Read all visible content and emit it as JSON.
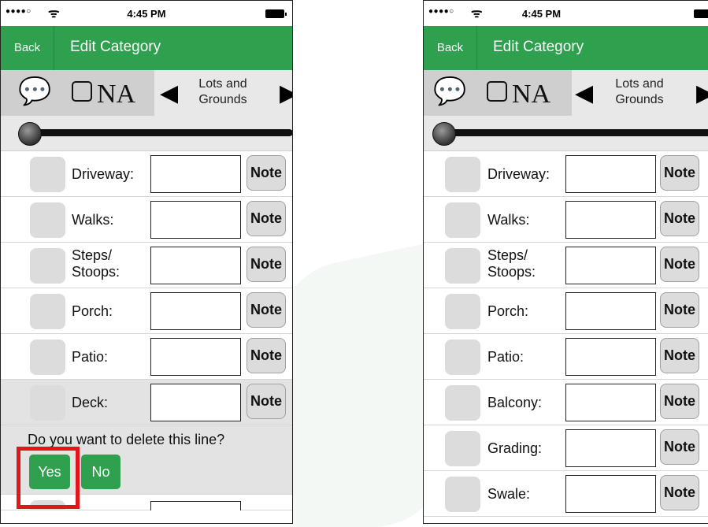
{
  "status": {
    "signal": "●●●●○",
    "wifi": "ᯤ",
    "time": "4:45 PM"
  },
  "nav": {
    "back": "Back",
    "title": "Edit Category"
  },
  "toolbar": {
    "chat_glyph": "💬",
    "na_label": "NA",
    "prev_glyph": "◀",
    "category_line1": "Lots and",
    "category_line2": "Grounds",
    "next_glyph": "▶"
  },
  "note_label": "Note",
  "left_rows": [
    {
      "label": "Driveway:"
    },
    {
      "label": "Walks:"
    },
    {
      "label_line1": "Steps/",
      "label_line2": "Stoops:"
    },
    {
      "label": "Porch:"
    },
    {
      "label": "Patio:"
    },
    {
      "label": "Deck:"
    }
  ],
  "delete_prompt": {
    "question": "Do you want to delete this line?",
    "yes": "Yes",
    "no": "No"
  },
  "right_rows": [
    {
      "label": "Driveway:"
    },
    {
      "label": "Walks:"
    },
    {
      "label_line1": "Steps/",
      "label_line2": "Stoops:"
    },
    {
      "label": "Porch:"
    },
    {
      "label": "Patio:"
    },
    {
      "label": "Balcony:"
    },
    {
      "label": "Grading:"
    },
    {
      "label": "Swale:"
    }
  ],
  "colors": {
    "accent_green": "#2ea04e",
    "highlight_red": "#e0161c"
  }
}
